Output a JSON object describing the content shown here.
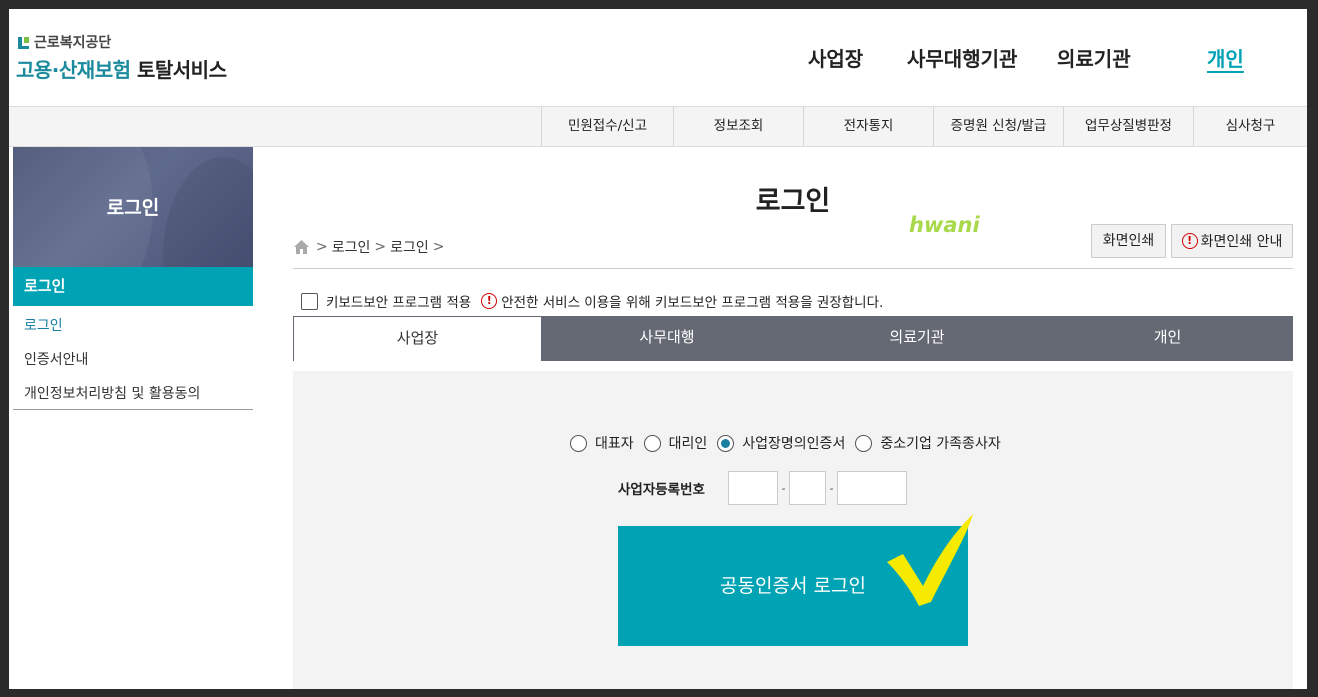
{
  "header": {
    "org_name": "근로복지공단",
    "service_accent": "고용·산재보험",
    "service_rest": " 토탈서비스",
    "gnb": [
      "사업장",
      "사무대행기관",
      "의료기관",
      "개인"
    ],
    "gnb_active": "개인"
  },
  "subnav": [
    "민원접수/신고",
    "정보조회",
    "전자통지",
    "증명원 신청/발급",
    "업무상질병판정",
    "심사청구"
  ],
  "sidebar": {
    "title": "로그인",
    "active": "로그인",
    "items": [
      "로그인",
      "인증서안내",
      "개인정보처리방침 및 활용동의"
    ]
  },
  "main": {
    "title": "로그인",
    "breadcrumb": [
      "로그인",
      "로그인"
    ],
    "watermark": "hwani",
    "print_button": "화면인쇄",
    "print_guide_button": "화면인쇄 안내",
    "keyboard_security_label": "키보드보안 프로그램 적용",
    "keyboard_security_notice": "안전한 서비스 이용을 위해 키보드보안 프로그램 적용을 권장합니다.",
    "tabs": [
      "사업장",
      "사무대행",
      "의료기관",
      "개인"
    ],
    "active_tab": "사업장",
    "login_types": [
      "대표자",
      "대리인",
      "사업장명의인증서",
      "중소기업 가족종사자"
    ],
    "selected_login_type": "사업장명의인증서",
    "biz_number_label": "사업자등록번호",
    "biz_number_values": [
      "",
      "",
      ""
    ],
    "biz_separator": "-",
    "login_button": "공동인증서 로그인"
  },
  "colors": {
    "accent": "#00a3b4",
    "sidebar_header": "#4f5a7c",
    "tab_bar": "#646973",
    "warning": "#d10000",
    "watermark": "#a8d94a",
    "checkmark": "#f5ea00"
  },
  "icons": [
    "home-icon",
    "warning-icon",
    "checkmark-icon",
    "logo-mark-icon"
  ]
}
